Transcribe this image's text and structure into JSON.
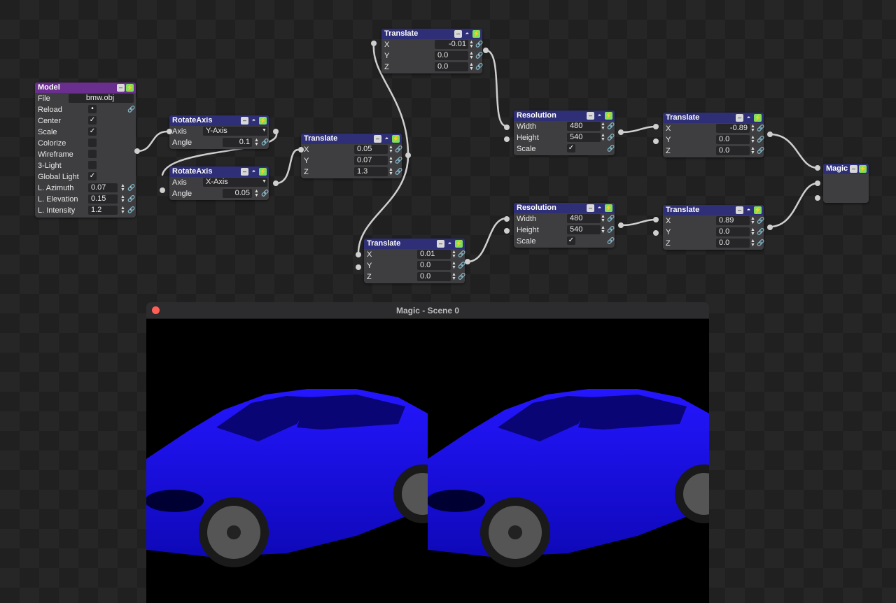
{
  "model": {
    "title": "Model",
    "rows": [
      {
        "label": "File",
        "value": "bmw.obj"
      },
      {
        "label": "Reload"
      },
      {
        "label": "Center"
      },
      {
        "label": "Scale"
      },
      {
        "label": "Colorize"
      },
      {
        "label": "Wireframe"
      },
      {
        "label": "3-Light"
      },
      {
        "label": "Global Light"
      },
      {
        "label": "L. Azimuth",
        "value": "0.07"
      },
      {
        "label": "L. Elevation",
        "value": "0.15"
      },
      {
        "label": "L. Intensity",
        "value": "1.2"
      }
    ],
    "checks": {
      "center": true,
      "scale": true,
      "colorize": false,
      "wireframe": false,
      "three_light": false,
      "global_light": true
    }
  },
  "rotate_axis_1": {
    "title": "RotateAxis",
    "axis_label": "Axis",
    "axis_value": "Y-Axis",
    "angle_label": "Angle",
    "angle_value": "0.1"
  },
  "rotate_axis_2": {
    "title": "RotateAxis",
    "axis_label": "Axis",
    "axis_value": "X-Axis",
    "angle_label": "Angle",
    "angle_value": "0.05"
  },
  "translate_mid": {
    "title": "Translate",
    "x": "0.05",
    "y": "0.07",
    "z": "1.3"
  },
  "translate_top": {
    "title": "Translate",
    "x": "-0.01",
    "y": "0.0",
    "z": "0.0"
  },
  "translate_bottom": {
    "title": "Translate",
    "x": "0.01",
    "y": "0.0",
    "z": "0.0"
  },
  "resolution_top": {
    "title": "Resolution",
    "width_label": "Width",
    "width": "480",
    "height_label": "Height",
    "height": "540",
    "scale_label": "Scale",
    "scale_checked": true
  },
  "resolution_bottom": {
    "title": "Resolution",
    "width_label": "Width",
    "width": "480",
    "height_label": "Height",
    "height": "540",
    "scale_label": "Scale",
    "scale_checked": true
  },
  "translate_right_top": {
    "title": "Translate",
    "x": "-0.89",
    "y": "0.0",
    "z": "0.0"
  },
  "translate_right_bottom": {
    "title": "Translate",
    "x": "0.89",
    "y": "0.0",
    "z": "0.0"
  },
  "magic": {
    "title": "Magic"
  },
  "axis_labels": {
    "x": "X",
    "y": "Y",
    "z": "Z"
  },
  "viewer": {
    "title": "Magic - Scene 0"
  },
  "colors": {
    "car": "#1c10ff",
    "node_header": "#2f2f78",
    "model_header": "#6a2f8e",
    "run_icon": "#7de05a"
  }
}
